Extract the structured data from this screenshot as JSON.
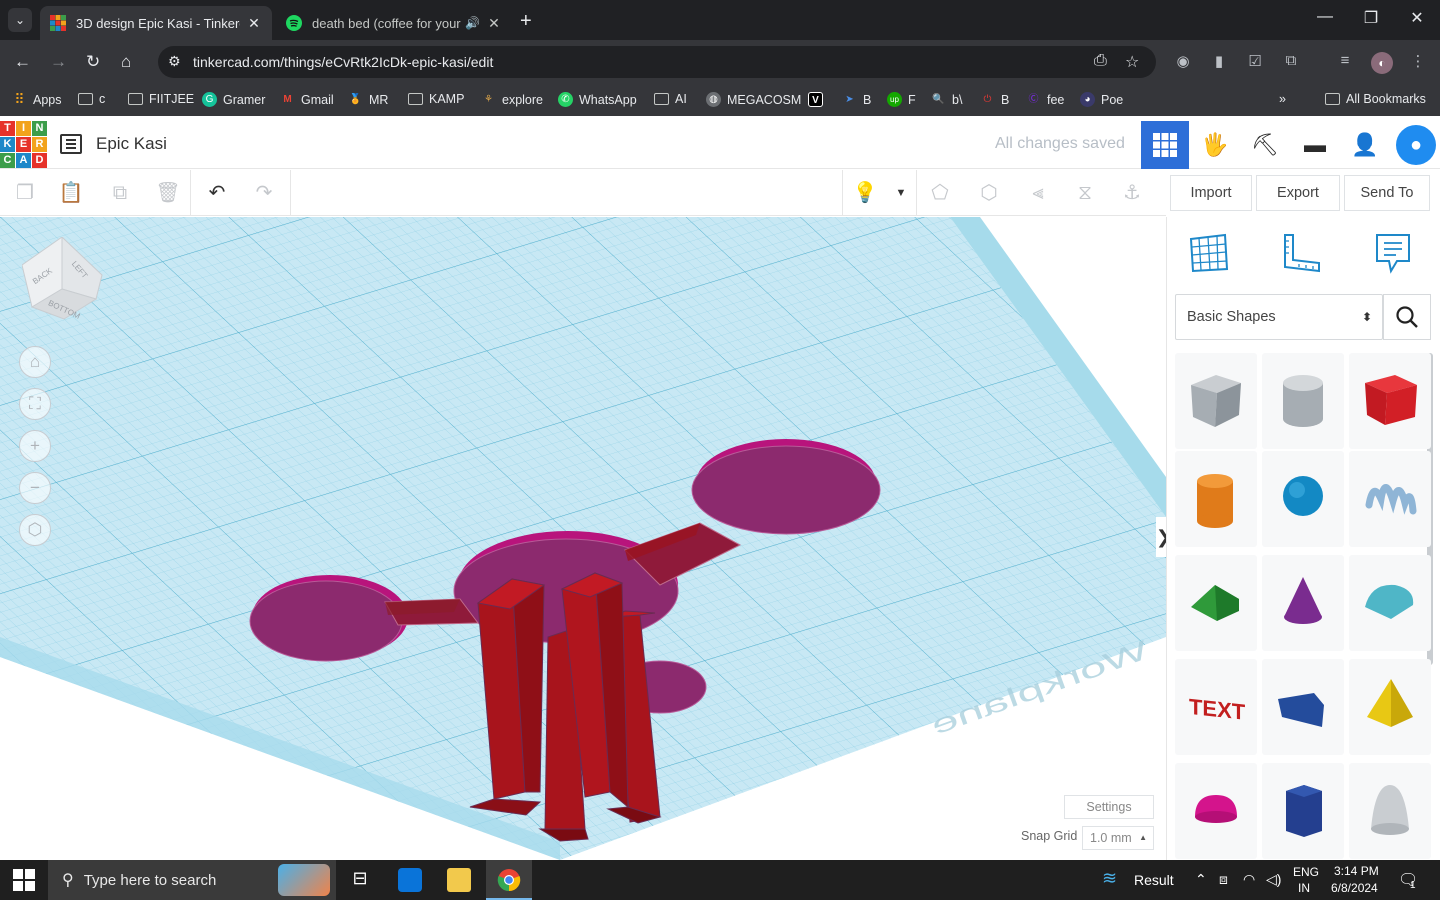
{
  "browser": {
    "tabs": [
      {
        "title": "3D design Epic Kasi - Tinkercad",
        "active": true
      },
      {
        "title": "death bed (coffee for your he",
        "active": false,
        "playing_audio": true
      }
    ],
    "url": "tinkercad.com/things/eCvRtk2IcDk-epic-kasi/edit",
    "bookmarks": [
      {
        "label": "Apps",
        "icon": "apps-grid-icon"
      },
      {
        "label": "c",
        "icon": "folder-icon"
      },
      {
        "label": "FIITJEE",
        "icon": "folder-icon"
      },
      {
        "label": "Gramer",
        "icon": "grammarly-icon"
      },
      {
        "label": "Gmail",
        "icon": "gmail-icon"
      },
      {
        "label": "MR",
        "icon": "medal-icon"
      },
      {
        "label": "KAMP",
        "icon": "folder-icon"
      },
      {
        "label": "explore",
        "icon": "explore-icon"
      },
      {
        "label": "WhatsApp",
        "icon": "whatsapp-icon"
      },
      {
        "label": "AI",
        "icon": "folder-icon"
      },
      {
        "label": "MEGACOSM",
        "icon": "globe-icon"
      },
      {
        "label": "",
        "icon": "v-icon"
      },
      {
        "label": "B",
        "icon": "bing-icon"
      },
      {
        "label": "F",
        "icon": "upwork-icon"
      },
      {
        "label": "b\\",
        "icon": "search-icon"
      },
      {
        "label": "B",
        "icon": "adobe-icon"
      },
      {
        "label": "fee",
        "icon": "canva-icon"
      },
      {
        "label": "Poe",
        "icon": "poe-icon"
      }
    ],
    "all_bookmarks_label": "All Bookmarks"
  },
  "tinkercad": {
    "logo_letters": [
      "T",
      "I",
      "N",
      "K",
      "E",
      "R",
      "C",
      "A",
      "D"
    ],
    "project_title": "Epic Kasi",
    "save_status": "All changes saved",
    "toolbar_actions": {
      "import": "Import",
      "export": "Export",
      "send_to": "Send To"
    },
    "viewcube_labels": [
      "BACK",
      "LEFT",
      "BOTTOM"
    ],
    "workplane_label": "Workplane",
    "settings_label": "Settings",
    "snap_grid_label": "Snap Grid",
    "snap_grid_value": "1.0 mm",
    "shape_library": "Basic Shapes",
    "shapes": [
      {
        "name": "Transparent Box",
        "color": "#9aa1a8"
      },
      {
        "name": "Transparent Cylinder",
        "color": "#a6adb3"
      },
      {
        "name": "Box",
        "color": "#d21f26"
      },
      {
        "name": "Cylinder",
        "color": "#e07b1a"
      },
      {
        "name": "Sphere",
        "color": "#1389c4"
      },
      {
        "name": "Scribble",
        "color": "#8fb5d6"
      },
      {
        "name": "Roof",
        "color": "#2f9a3a"
      },
      {
        "name": "Cone",
        "color": "#7a2c8f"
      },
      {
        "name": "Round Roof",
        "color": "#4fb6c7"
      },
      {
        "name": "Text",
        "color": "#c21f1f"
      },
      {
        "name": "Wedge",
        "color": "#244c9c"
      },
      {
        "name": "Pyramid",
        "color": "#e8c814"
      },
      {
        "name": "Half Sphere",
        "color": "#d4148c"
      },
      {
        "name": "Polygon",
        "color": "#243f8f"
      },
      {
        "name": "Paraboloid",
        "color": "#c9cdd1"
      }
    ]
  },
  "taskbar": {
    "search_placeholder": "Type here to search",
    "weather": "Result",
    "language": "ENG",
    "region": "IN",
    "time": "3:14 PM",
    "date": "6/8/2024",
    "notifications": "1"
  },
  "colors": {
    "accent": "#2e6fd8",
    "workplane": "#bfe4f2",
    "grid": "#6fc2dc",
    "model_magenta": "#a3165f",
    "model_red": "#a8141c"
  }
}
